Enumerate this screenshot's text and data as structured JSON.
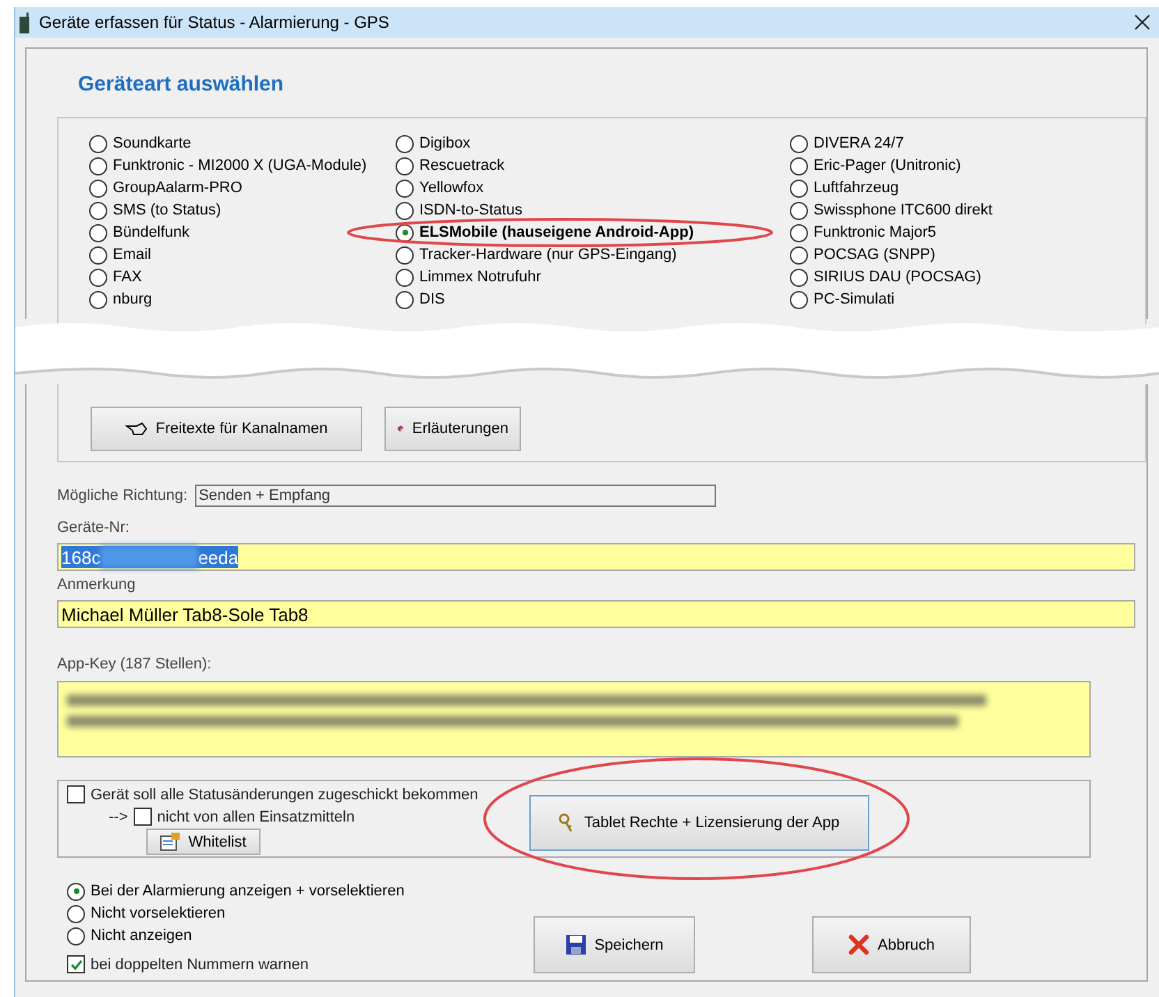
{
  "window": {
    "title": "Geräte erfassen für Status - Alarmierung - GPS"
  },
  "heading": "Geräteart auswählen",
  "device_types": [
    [
      {
        "label": "Soundkarte",
        "selected": false
      },
      {
        "label": "Funktronic - MI2000 X (UGA-Module)",
        "selected": false
      },
      {
        "label": "GroupAalarm-PRO",
        "selected": false
      },
      {
        "label": "SMS (to Status)",
        "selected": false
      },
      {
        "label": "Bündelfunk",
        "selected": false
      },
      {
        "label": "Email",
        "selected": false
      },
      {
        "label": "FAX",
        "selected": false
      },
      {
        "label": "nburg",
        "selected": false
      }
    ],
    [
      {
        "label": "Digibox",
        "selected": false
      },
      {
        "label": "Rescuetrack",
        "selected": false
      },
      {
        "label": "Yellowfox",
        "selected": false
      },
      {
        "label": "ISDN-to-Status",
        "selected": false
      },
      {
        "label": "ELSMobile (hauseigene Android-App)",
        "selected": true
      },
      {
        "label": "Tracker-Hardware (nur GPS-Eingang)",
        "selected": false
      },
      {
        "label": "Limmex Notrufuhr",
        "selected": false
      },
      {
        "label": "DIS",
        "selected": false
      }
    ],
    [
      {
        "label": "DIVERA 24/7",
        "selected": false
      },
      {
        "label": "Eric-Pager (Unitronic)",
        "selected": false
      },
      {
        "label": "Luftfahrzeug",
        "selected": false
      },
      {
        "label": "Swissphone ITC600 direkt",
        "selected": false
      },
      {
        "label": "Funktronic Major5",
        "selected": false
      },
      {
        "label": "POCSAG (SNPP)",
        "selected": false
      },
      {
        "label": "SIRIUS DAU (POCSAG)",
        "selected": false
      },
      {
        "label": "PC-Simulati",
        "selected": false
      }
    ]
  ],
  "group_buttons": [
    "Freitexte für Kanalnamen",
    "Erläuterungen"
  ],
  "direction": {
    "label": "Mögliche Richtung:",
    "value": "Senden + Empfang"
  },
  "device_number": {
    "label": "Geräte-Nr:",
    "value_start": "168c",
    "value_end": "eeda"
  },
  "remark": {
    "label": "Anmerkung",
    "value": "Michael Müller Tab8-Sole Tab8"
  },
  "app_key": {
    "label": "App-Key (187 Stellen):"
  },
  "status_options": {
    "all_changes": {
      "label": "Gerät soll alle Statusänderungen zugeschickt bekommen",
      "checked": false
    },
    "arrow": "-->",
    "not_all": {
      "label": "nicht von allen Einsatzmitteln",
      "checked": false
    },
    "whitelist_button": "Whitelist",
    "tablet_button": "Tablet Rechte + Lizensierung der App"
  },
  "display_options": [
    {
      "label": "Bei der Alarmierung anzeigen + vorselektieren",
      "selected": true
    },
    {
      "label": "Nicht vorselektieren",
      "selected": false
    },
    {
      "label": "Nicht anzeigen",
      "selected": false
    }
  ],
  "warn_duplicates": {
    "label": "bei doppelten Nummern warnen",
    "checked": true
  },
  "save_button": "Speichern",
  "cancel_button": "Abbruch"
}
